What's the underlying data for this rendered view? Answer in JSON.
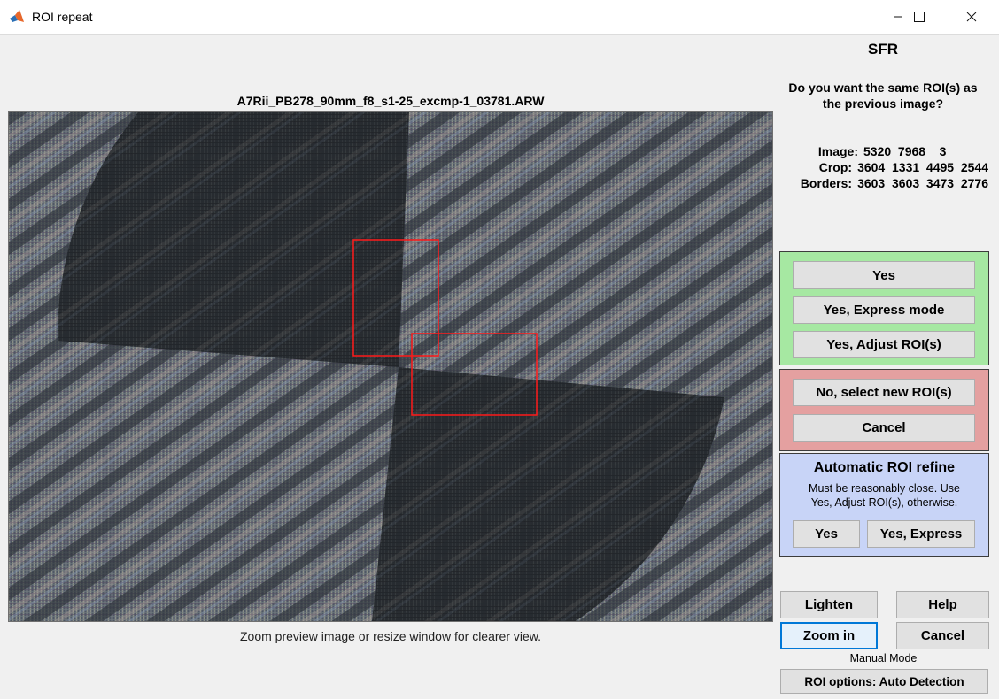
{
  "window": {
    "title": "ROI repeat",
    "controls": [
      "minimize-icon",
      "maximize-icon",
      "close-icon"
    ]
  },
  "image": {
    "filename": "A7Rii_PB278_90mm_f8_s1-25_excmp-1_03781.ARW",
    "zoom_note": "Zoom preview image or resize window for clearer view."
  },
  "panel": {
    "title": "SFR",
    "question_line1": "Do you want the same ROI(s) as",
    "question_line2": "the previous image?",
    "info": [
      {
        "label": "Image:",
        "value": "5320  7968    3"
      },
      {
        "label": "Crop:",
        "value": "3604  1331  4495  2544"
      },
      {
        "label": "Borders:",
        "value": "3603  3603  3473  2776"
      }
    ]
  },
  "green_panel": {
    "yes": "Yes",
    "yes_express": "Yes, Express mode",
    "yes_adjust": "Yes, Adjust ROI(s)",
    "color": "#a6e8a2"
  },
  "red_panel": {
    "no_select": "No, select new ROI(s)",
    "cancel": "Cancel",
    "color": "#e4a0a0"
  },
  "blue_panel": {
    "title": "Automatic ROI refine",
    "note_line1": "Must be reasonably close. Use",
    "note_line2": "Yes, Adjust ROI(s), otherwise.",
    "yes": "Yes",
    "yes_express": "Yes, Express",
    "color": "#c8d4f7"
  },
  "bottom": {
    "lighten": "Lighten",
    "help": "Help",
    "zoom_in": "Zoom in",
    "cancel": "Cancel",
    "manual_mode": "Manual Mode",
    "roi_options": "ROI options: Auto Detection"
  },
  "roi_color": "#ff1a1a"
}
